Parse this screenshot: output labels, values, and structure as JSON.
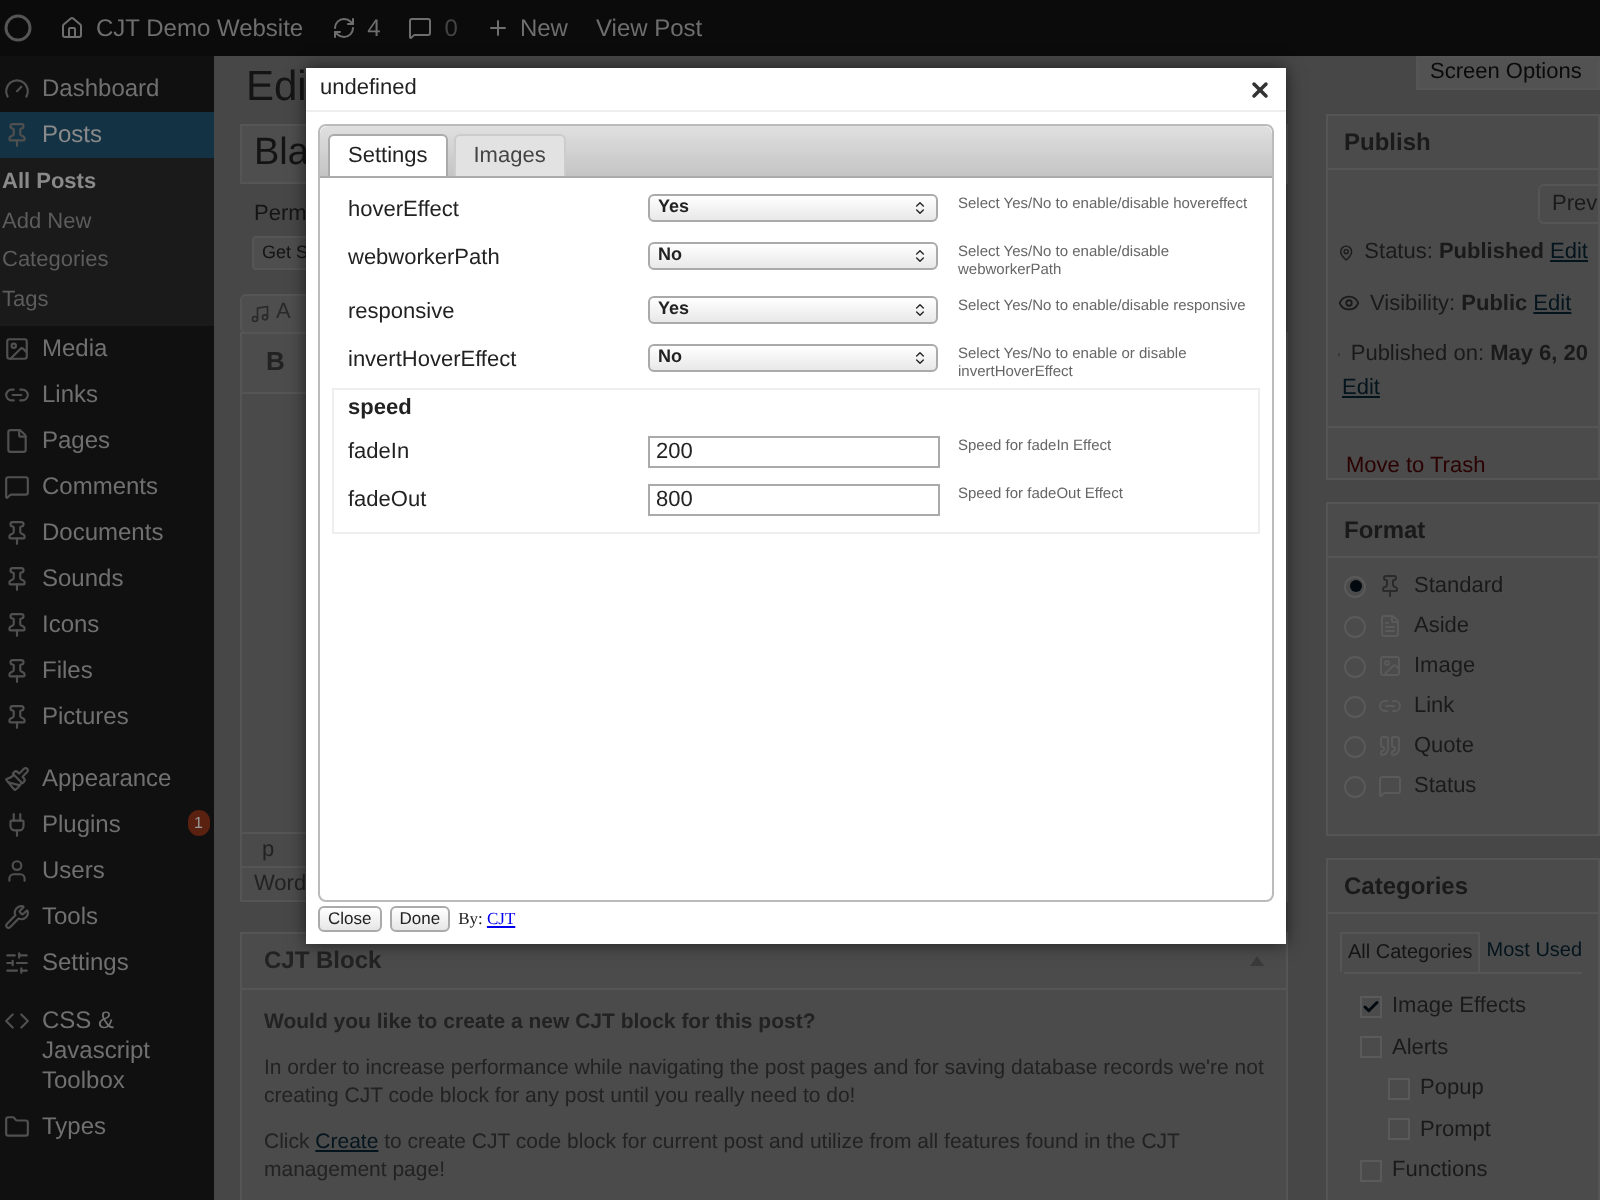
{
  "admin_bar": {
    "site_name": "CJT Demo Website",
    "updates": "4",
    "comments": "0",
    "new": "New",
    "view_post": "View Post"
  },
  "screen_options": "Screen Options",
  "sidebar": {
    "items": [
      {
        "label": "Dashboard",
        "selected": false
      },
      {
        "label": "Posts",
        "selected": true,
        "children": [
          {
            "label": "All Posts",
            "selected": true
          },
          {
            "label": "Add New",
            "selected": false
          },
          {
            "label": "Categories",
            "selected": false
          },
          {
            "label": "Tags",
            "selected": false
          }
        ]
      },
      {
        "label": "Media",
        "selected": false
      },
      {
        "label": "Links",
        "selected": false
      },
      {
        "label": "Pages",
        "selected": false
      },
      {
        "label": "Comments",
        "selected": false
      },
      {
        "label": "Documents",
        "selected": false
      },
      {
        "label": "Sounds",
        "selected": false
      },
      {
        "label": "Icons",
        "selected": false
      },
      {
        "label": "Files",
        "selected": false
      },
      {
        "label": "Pictures",
        "selected": false
      },
      {
        "label": "Appearance",
        "selected": false
      },
      {
        "label": "Plugins",
        "selected": false,
        "badge": "1"
      },
      {
        "label": "Users",
        "selected": false
      },
      {
        "label": "Tools",
        "selected": false
      },
      {
        "label": "Settings",
        "selected": false
      },
      {
        "label": "CSS & Javascript Toolbox",
        "selected": false
      },
      {
        "label": "Types",
        "selected": false
      }
    ]
  },
  "editor": {
    "heading": "Edi",
    "post_title": "Bla",
    "permalink_label": "Perm",
    "shortlink_button": "Get S",
    "add_media_button": "A",
    "toolbar_button": "B",
    "path": "p",
    "word_count": "Word"
  },
  "cjt_block": {
    "title": "CJT Block",
    "question": "Would you like to create a new CJT block for this post?",
    "paragraph": "In order to increase performance while navigating the post pages and for saving database records we're not creating CJT code block for any post until you really need to do!",
    "link_before": "Click",
    "link": "Create",
    "link_after": "to create CJT code block for current post and utilize from all features found in the CJT management page!"
  },
  "publish": {
    "title": "Publish",
    "preview_button": "Prev",
    "status": "Status: **Published**",
    "status_edit": "Edit",
    "visibility": "Visibility: **Public**",
    "visibility_edit": "Edit",
    "published_on": "Published on: **May 6, 20**",
    "published_on_edit": "Edit",
    "trash": "Move to Trash"
  },
  "format": {
    "title": "Format",
    "options": [
      {
        "label": "Standard",
        "selected": true
      },
      {
        "label": "Aside",
        "selected": false
      },
      {
        "label": "Image",
        "selected": false
      },
      {
        "label": "Link",
        "selected": false
      },
      {
        "label": "Quote",
        "selected": false
      },
      {
        "label": "Status",
        "selected": false
      }
    ]
  },
  "categories": {
    "title": "Categories",
    "tabs": [
      {
        "label": "All Categories",
        "selected": true
      },
      {
        "label": "Most Used",
        "selected": false
      }
    ],
    "items": [
      {
        "label": "Image Effects",
        "checked": true
      },
      {
        "label": "Alerts",
        "checked": false,
        "children": [
          {
            "label": "Popup",
            "checked": false
          },
          {
            "label": "Prompt",
            "checked": false
          }
        ]
      },
      {
        "label": "Functions",
        "checked": false
      }
    ]
  },
  "modal": {
    "title": "undefined",
    "tabs": [
      {
        "label": "Settings",
        "selected": true
      },
      {
        "label": "Images",
        "selected": false
      }
    ],
    "fields": [
      {
        "kind": "select",
        "label": "hoverEffect",
        "value": "Yes",
        "help": "Select Yes/No to enable/disable hovereffect"
      },
      {
        "kind": "select",
        "label": "webworkerPath",
        "value": "No",
        "help": "Select Yes/No to enable/disable webworkerPath"
      },
      {
        "kind": "select",
        "label": "responsive",
        "value": "Yes",
        "help": "Select Yes/No to enable/disable responsive"
      },
      {
        "kind": "select",
        "label": "invertHoverEffect",
        "value": "No",
        "help": "Select Yes/No to enable or disable invertHoverEffect"
      }
    ],
    "group": {
      "title": "speed",
      "fields": [
        {
          "kind": "input",
          "label": "fadeIn",
          "value": "200",
          "help": "Speed for fadeIn Effect"
        },
        {
          "kind": "input",
          "label": "fadeOut",
          "value": "800",
          "help": "Speed for fadeOut Effect"
        }
      ]
    },
    "buttons": [
      "Close",
      "Done"
    ],
    "credit_prefix": "By:",
    "credit_link": "CJT"
  }
}
